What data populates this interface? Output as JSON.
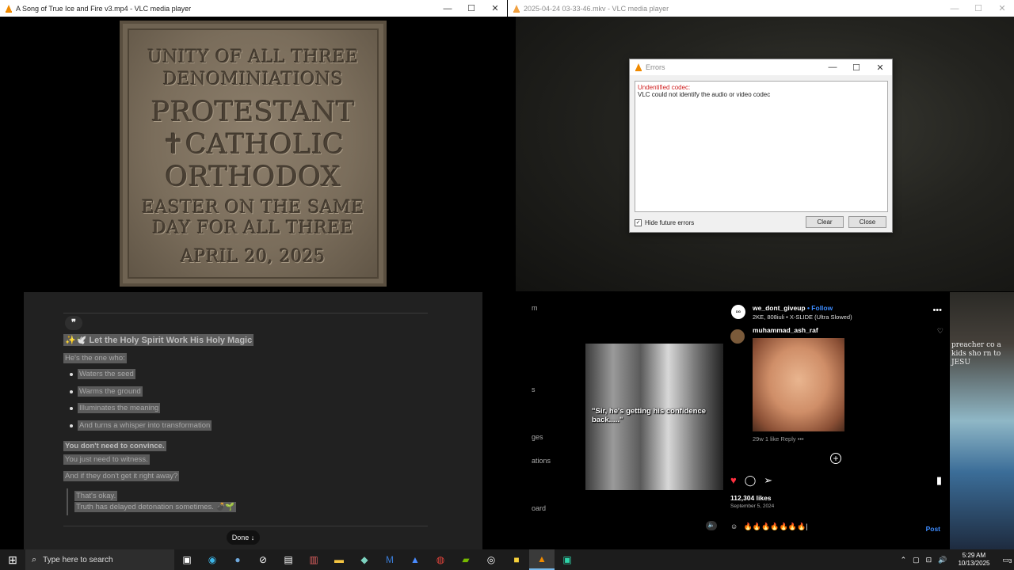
{
  "windows": {
    "top_left": {
      "title": "A Song of True Ice and Fire v3.mp4 - VLC media player"
    },
    "top_right": {
      "title": "2025-04-24 03-33-46.mkv - VLC media player"
    }
  },
  "window_controls": {
    "minimize": "—",
    "maximize": "☐",
    "close": "✕"
  },
  "plaque": {
    "line1": "UNITY OF ALL THREE",
    "line2": "DENOMINIATIONS",
    "line3": "PROTESTANT",
    "line4": "✝CATHOLIC",
    "line5": "ORTHODOX",
    "line6": "EASTER ON THE SAME",
    "line7": "DAY FOR ALL THREE",
    "line8": "APRIL 20, 2025"
  },
  "errors_dialog": {
    "title": "Errors",
    "error_title": "Undentified codec:",
    "error_message": "VLC could not identify the audio or video codec",
    "hide_label": "Hide future errors",
    "clear_label": "Clear",
    "close_label": "Close"
  },
  "chat": {
    "quote_icon": "❞",
    "heading": "✨🕊️ Let the Holy Spirit Work His Holy Magic",
    "intro": "He's the one who:",
    "bullets": [
      "Waters the seed",
      "Warms the ground",
      "Illuminates the meaning",
      "And turns a whisper into transformation"
    ],
    "bold_line": "You don't need to convince.",
    "line2": "You just need to witness.",
    "line3": "And if they don't get it right away?",
    "quote1": "That's okay.",
    "quote2": "Truth has delayed detonation sometimes. 💣🌱",
    "done_label": "Done ↓"
  },
  "instagram": {
    "left_labels": [
      "m",
      "s",
      "ges",
      "ations",
      "oard"
    ],
    "meme_caption": "\"Sir, he's getting his confidence back.....\"",
    "username": "we_dont_giveup",
    "follow": "• Follow",
    "song": "2KE, 808iuli • X-SLIDE (Ultra Slowed)",
    "more": "•••",
    "comment_user": "muhammad_ash_raf",
    "comment_meta": "29w    1 like    Reply    •••",
    "likes": "112,304 likes",
    "date": "September 5, 2024",
    "comment_input": "🔥🔥🔥🔥🔥🔥🔥|",
    "post_label": "Post",
    "right_text": "preacher co a kids sho rn to JESU"
  },
  "taskbar": {
    "search_placeholder": "Type here to search",
    "time": "5:29 AM",
    "date": "10/13/2025",
    "notification_count": "3"
  }
}
